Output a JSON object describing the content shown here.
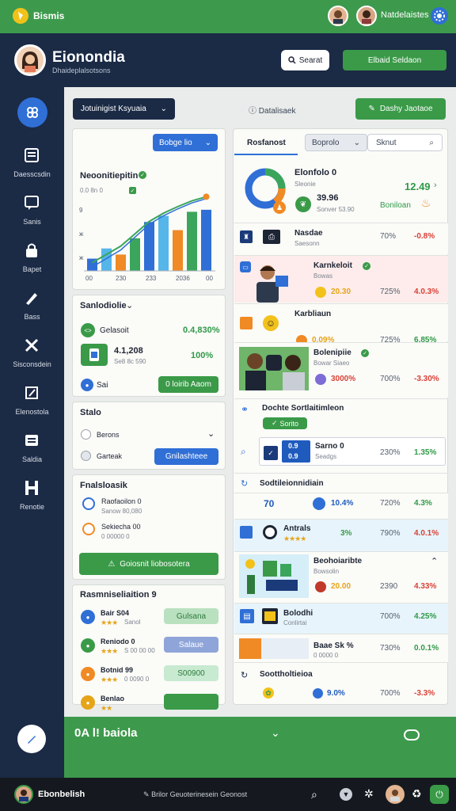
{
  "topbar": {
    "app_name": "Bismis",
    "user_name": "Natdelaistes"
  },
  "header": {
    "title": "Eionondia",
    "subtitle": "Dhaideplalsotsons",
    "search_label": "Searat",
    "action_label": "Elbaid Seldaon"
  },
  "sidebar": {
    "items": [
      {
        "label": "Daesscsdin",
        "icon": "document-icon"
      },
      {
        "label": "Sanis",
        "icon": "chat-icon"
      },
      {
        "label": "Bapet",
        "icon": "lock-icon"
      },
      {
        "label": "Bass",
        "icon": "pen-icon"
      },
      {
        "label": "Sisconsdein",
        "icon": "tools-icon"
      },
      {
        "label": "Elenostola",
        "icon": "edit-icon"
      },
      {
        "label": "Saldia",
        "icon": "list-icon"
      },
      {
        "label": "Renotie",
        "icon": "building-icon"
      }
    ]
  },
  "toolbar": {
    "dropdown_label": "Jotuinigist Ksyuaia",
    "center_label": "Datalisaek",
    "action_label": "Dashy Jaotaoe"
  },
  "chart_card": {
    "dropdown_label": "Bobge lio",
    "title": "Neoonitiepitin",
    "subtitle": "0.0 8n 0",
    "x_labels": [
      "00",
      "230",
      "233",
      "2036",
      "00"
    ],
    "y_labels": [
      "9",
      "ж",
      "ж"
    ]
  },
  "chart_data": {
    "type": "bar",
    "categories": [
      "00",
      "230",
      "233",
      "2036",
      "00"
    ],
    "series": [
      {
        "values": [
          12,
          22,
          16,
          32,
          48,
          54,
          40,
          58,
          60
        ]
      }
    ],
    "line": [
      10,
      20,
      30,
      45,
      60,
      70,
      78,
      85,
      90
    ],
    "colors": [
      "#2f6fd6",
      "#56b5e9",
      "#f08a24",
      "#3ba55c"
    ]
  },
  "summary_card": {
    "title": "Sanlodiolie",
    "row1_label": "Gelasoit",
    "row1_value": "0.4,830%",
    "row2_value_main": "4.1,208",
    "row2_value_sub": "Se8 8c 590",
    "row2_pct": "100%",
    "button_prefix": "Sai",
    "button_label": "0 loirib Aaom"
  },
  "status_card": {
    "title": "Stalo",
    "option1": "Berons",
    "option2": "Garteak",
    "button_label": "Gnilashteee"
  },
  "trending_card": {
    "title": "Fnalsloasik",
    "items": [
      {
        "name": "Raofaoilon 0",
        "sub": "Sanow 80,080"
      },
      {
        "name": "Sekiecha 00",
        "sub": "0 00000 0"
      }
    ],
    "banner": "Goiosnit liobosotera"
  },
  "ranking_card": {
    "title": "Rasmniseliaition 9",
    "items": [
      {
        "name": "Bair S04",
        "stars": "★★★",
        "sub": "Sanol",
        "chip": "Gulsana"
      },
      {
        "name": "Reniodo 0",
        "stars": "★★★",
        "sub": "S 00 00 00",
        "chip": "Salaue"
      },
      {
        "name": "Botnid 99",
        "stars": "★★★",
        "sub": "0 0090 0",
        "chip": "S00900"
      },
      {
        "name": "Benlao",
        "stars": "★★",
        "sub": "",
        "chip": ""
      }
    ]
  },
  "right_panel": {
    "tabs": [
      "Rosfanost",
      "Boprolo",
      "Sknut"
    ],
    "highlight": {
      "name": "Elonfolo 0",
      "sub": "Sleonie",
      "value": "12.49",
      "amount": "39.96",
      "amount_sub": "Sonver 53.90",
      "status": "Boniloan"
    },
    "rows": [
      {
        "name": "Nasdae",
        "sub": "Saesonn",
        "pct1": "70%",
        "pct2": "-0.8%",
        "pct2_class": "neg"
      },
      {
        "name": "Karnkeloit",
        "sub": "Bowas",
        "val": "20.30",
        "pct1": "725%",
        "pct2": "4.0.3%",
        "pct2_class": "neg"
      },
      {
        "name": "Karbliaun",
        "sub": "",
        "val": "0.09%",
        "pct1": "725%",
        "pct2": "6.85%",
        "pct2_class": "pos"
      },
      {
        "name": "Bolenipiie",
        "sub": "Bowar Siaeo",
        "val": "3000%",
        "pct1": "700%",
        "pct2": "-3.30%",
        "pct2_class": "neg"
      }
    ],
    "section1": {
      "title": "Dochte Sortlaitimleon",
      "chip": "Sorito",
      "box_values": [
        "0.9",
        "0.9"
      ],
      "box_name": "Sarno 0",
      "box_sub": "Seadgs",
      "pct1": "230%",
      "pct2": "1.35%"
    },
    "section2": {
      "title": "Sodtileionnidiain",
      "rows": [
        {
          "name": "70",
          "val": "10.4%",
          "pct1": "720%",
          "pct2": "4.3%",
          "pct2_class": "pos"
        },
        {
          "name": "Antrals",
          "stars": "★★★★",
          "val": "3%",
          "pct1": "790%",
          "pct2": "4.0.1%",
          "pct2_class": "neg"
        },
        {
          "name": "Beohoiaribte",
          "sub": "Bowsolin",
          "val": "20.00",
          "pct1": "2390",
          "pct2": "4.33%",
          "pct2_class": "neg"
        },
        {
          "name": "Bolodhi",
          "sub": "Conlirtai",
          "val": "",
          "pct1": "700%",
          "pct2": "4.25%",
          "pct2_class": "pos"
        },
        {
          "name": "Baae Sk %",
          "sub": "0 0000 0",
          "val": "",
          "pct1": "730%",
          "pct2": "0.0.1%",
          "pct2_class": "pos"
        }
      ]
    },
    "section3": {
      "title": "Soottholtieioa",
      "val": "9.0%",
      "pct1": "700%",
      "pct2": "-3.3%"
    }
  },
  "bottom": {
    "title": "0A l! baiola"
  },
  "taskbar": {
    "user": "Ebonbelish",
    "center_text": "Brilor Geuoterinesein Geonost"
  }
}
